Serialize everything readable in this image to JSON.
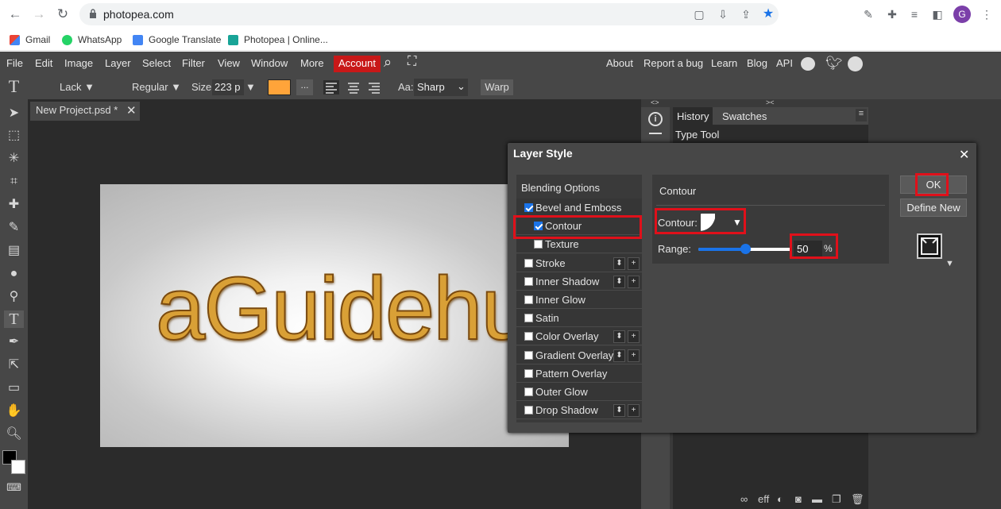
{
  "browser": {
    "url": "photopea.com",
    "bookmarks": [
      "Gmail",
      "WhatsApp",
      "Google Translate",
      "Photopea | Online..."
    ],
    "avatar_letter": "G"
  },
  "app": {
    "menu": [
      "File",
      "Edit",
      "Image",
      "Layer",
      "Select",
      "Filter",
      "View",
      "Window",
      "More"
    ],
    "account_label": "Account",
    "right_menu": [
      "About",
      "Report a bug",
      "Learn",
      "Blog",
      "API"
    ],
    "options": {
      "font": "Lack",
      "style": "Regular",
      "size_label": "Size:",
      "size_value": "223 p",
      "ellipsis": "...",
      "aa_label": "Aa:",
      "aa_value": "Sharp",
      "warp": "Warp",
      "text_color": "#ffa43a"
    },
    "doc_tab": "New Project.psd *",
    "canvas_text": "aGuidehub",
    "panels": {
      "history_tab": "History",
      "swatches_tab": "Swatches",
      "history_item": "Type Tool",
      "footer_eff": "eff"
    }
  },
  "dialog": {
    "title": "Layer Style",
    "styles_header": "Blending Options",
    "styles": [
      {
        "label": "Bevel and Emboss",
        "checked": true,
        "indent": false,
        "buttons": false
      },
      {
        "label": "Contour",
        "checked": true,
        "indent": true,
        "buttons": false
      },
      {
        "label": "Texture",
        "checked": false,
        "indent": true,
        "buttons": false
      },
      {
        "label": "Stroke",
        "checked": false,
        "indent": false,
        "buttons": true
      },
      {
        "label": "Inner Shadow",
        "checked": false,
        "indent": false,
        "buttons": true
      },
      {
        "label": "Inner Glow",
        "checked": false,
        "indent": false,
        "buttons": false
      },
      {
        "label": "Satin",
        "checked": false,
        "indent": false,
        "buttons": false
      },
      {
        "label": "Color Overlay",
        "checked": false,
        "indent": false,
        "buttons": true
      },
      {
        "label": "Gradient Overlay",
        "checked": false,
        "indent": false,
        "buttons": true
      },
      {
        "label": "Pattern Overlay",
        "checked": false,
        "indent": false,
        "buttons": false
      },
      {
        "label": "Outer Glow",
        "checked": false,
        "indent": false,
        "buttons": false
      },
      {
        "label": "Drop Shadow",
        "checked": false,
        "indent": false,
        "buttons": true
      }
    ],
    "section_title": "Contour",
    "contour_label": "Contour:",
    "range_label": "Range:",
    "range_value": "50",
    "range_fraction": 0.5,
    "percent": "%",
    "ok": "OK",
    "define_new": "Define New",
    "highlight_color": "#e0101a"
  }
}
